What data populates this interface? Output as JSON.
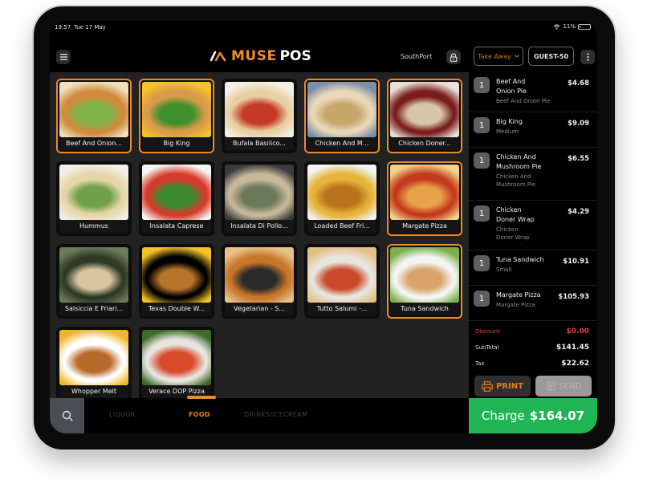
{
  "status_bar": {
    "time": "19:57",
    "date": "Tue 17 May",
    "battery": "11%",
    "battery_level": 0.11
  },
  "header": {
    "logo_brand": "MUSE",
    "logo_product": "POS",
    "location": "SouthPort",
    "order_type": "Take Away",
    "guest": "GUEST-50",
    "icons": {
      "menu": "hamburger-menu-icon",
      "lock": "lock-icon",
      "more": "vertical-dots-icon",
      "wifi": "wifi-icon"
    }
  },
  "products": [
    {
      "name": "Beef And Onion...",
      "selected": true,
      "palette": [
        "#d08a3c",
        "#7db24a",
        "#f0e0c0"
      ]
    },
    {
      "name": "Big King",
      "selected": true,
      "palette": [
        "#d99a4a",
        "#3f8f2a",
        "#f4c22a"
      ]
    },
    {
      "name": "Bufala Basilico...",
      "selected": false,
      "palette": [
        "#e8cfa2",
        "#c43a24",
        "#f4f0e6"
      ]
    },
    {
      "name": "Chicken And M...",
      "selected": true,
      "palette": [
        "#e9d8b8",
        "#c7a66a",
        "#7a8fa8"
      ]
    },
    {
      "name": "Chicken Doner...",
      "selected": true,
      "palette": [
        "#7a1d1d",
        "#d8c6a8",
        "#e8e0d8"
      ]
    },
    {
      "name": "Hummus",
      "selected": false,
      "palette": [
        "#e8d6a8",
        "#6fa04a",
        "#f2efe8"
      ]
    },
    {
      "name": "Insalata Caprese",
      "selected": false,
      "palette": [
        "#d63a2a",
        "#3c8a2e",
        "#f4f4f0"
      ]
    },
    {
      "name": "Insalata Di Pollo...",
      "selected": false,
      "palette": [
        "#c7b89a",
        "#6a7a5a",
        "#3b3b3b"
      ]
    },
    {
      "name": "Loaded Beef Fri...",
      "selected": false,
      "palette": [
        "#e6b43a",
        "#b8731c",
        "#f2f2f2"
      ]
    },
    {
      "name": "Margate Pizza",
      "selected": true,
      "palette": [
        "#c43a1c",
        "#e8a24a",
        "#f0d28a"
      ]
    },
    {
      "name": "Salsiccia E Friari...",
      "selected": false,
      "palette": [
        "#2f3a26",
        "#d8c6a0",
        "#6a7a5a"
      ]
    },
    {
      "name": "Texas Double W...",
      "selected": false,
      "palette": [
        "#000000",
        "#b8742a",
        "#f2c22a"
      ]
    },
    {
      "name": "Vegetarian - S...",
      "selected": false,
      "palette": [
        "#c9762a",
        "#2a2a2a",
        "#e8c28a"
      ]
    },
    {
      "name": "Tutto Salumi -...",
      "selected": false,
      "palette": [
        "#e8e4de",
        "#c84a2a",
        "#e2c08a"
      ]
    },
    {
      "name": "Tuna Sandwich",
      "selected": true,
      "palette": [
        "#f4f4f4",
        "#d8a46a",
        "#7ab04a"
      ]
    },
    {
      "name": "Whopper Melt",
      "selected": false,
      "palette": [
        "#ffffff",
        "#b86a2a",
        "#f2b62a"
      ]
    },
    {
      "name": "Verace DOP Pizza",
      "selected": false,
      "palette": [
        "#e8e4e0",
        "#d84a2a",
        "#3d6a2a"
      ]
    }
  ],
  "categories": [
    {
      "label": "LIQUOR",
      "active": false
    },
    {
      "label": "FOOD",
      "active": true
    },
    {
      "label": "DRINKS/ICECREAM",
      "active": false
    }
  ],
  "order": {
    "items": [
      {
        "qty": "1",
        "name_lines": [
          "Beef And",
          "Onion Pie"
        ],
        "sub_lines": [
          "Beef And Onion Pie"
        ],
        "price": "$4.68"
      },
      {
        "qty": "1",
        "name_lines": [
          "Big King"
        ],
        "sub_lines": [
          "Medium"
        ],
        "price": "$9.09"
      },
      {
        "qty": "1",
        "name_lines": [
          "Chicken And",
          "Mushroom Pie"
        ],
        "sub_lines": [
          "Chicken And",
          "Mushroom Pie"
        ],
        "price": "$6.55"
      },
      {
        "qty": "1",
        "name_lines": [
          "Chicken",
          "Doner Wrap"
        ],
        "sub_lines": [
          "Chicken",
          "Doner Wrap"
        ],
        "price": "$4.29"
      },
      {
        "qty": "1",
        "name_lines": [
          "Tuna Sandwich"
        ],
        "sub_lines": [
          "Small"
        ],
        "price": "$10.91"
      },
      {
        "qty": "1",
        "name_lines": [
          "Margate Pizza"
        ],
        "sub_lines": [
          "Margate Pizza"
        ],
        "price": "$105.93"
      }
    ],
    "discount_label": "Discount",
    "discount": "$0.00",
    "subtotal_label": "SubTotal",
    "subtotal": "$141.45",
    "tax_label": "Tax",
    "tax": "$22.62",
    "print_label": "PRINT",
    "send_label": "SEND",
    "charge_label": "Charge",
    "charge_amount": "$164.07"
  },
  "colors": {
    "accent": "#f08a24",
    "charge": "#1fb554",
    "discount": "#e0403a"
  }
}
